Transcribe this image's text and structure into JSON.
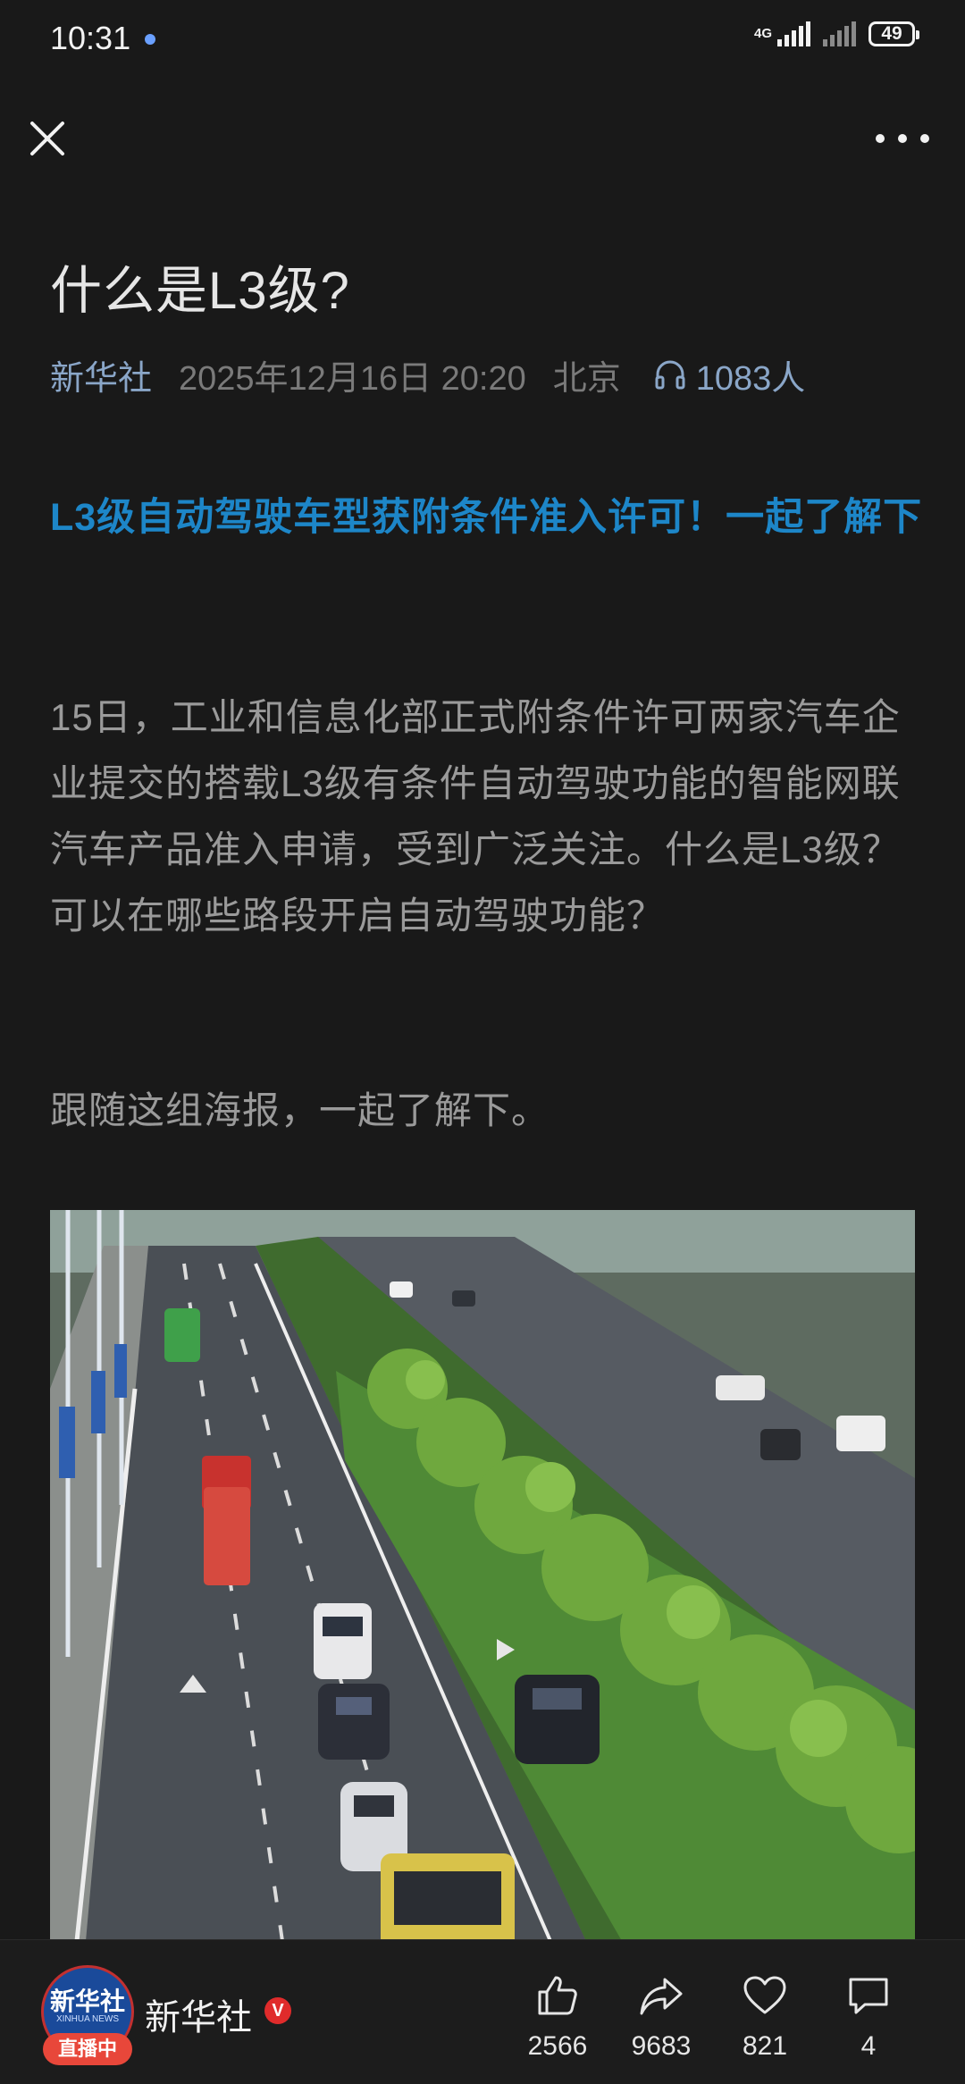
{
  "status_bar": {
    "time": "10:31",
    "network": "4G",
    "battery": "49"
  },
  "header": {
    "close_icon": "close-icon",
    "more_icon": "more-dots-icon"
  },
  "article": {
    "title": "什么是L3级?",
    "source": "新华社",
    "date": "2025年12月16日 20:20",
    "location": "北京",
    "listeners": "1083人",
    "subtitle": "L3级自动驾驶车型获附条件准入许可！一起了解下",
    "paragraphs": [
      "15日，工业和信息化部正式附条件许可两家汽车企业提交的搭载L3级有条件自动驾驶功能的智能网联汽车产品准入申请，受到广泛关注。什么是L3级？可以在哪些路段开启自动驾驶功能？",
      "跟随这组海报，一起了解下。"
    ]
  },
  "bottom_bar": {
    "avatar_text": "新华社",
    "avatar_sub": "XINHUA NEWS",
    "live_label": "直播中",
    "author": "新华社",
    "verified": "V",
    "likes": "2566",
    "shares": "9683",
    "favorites": "821",
    "comments": "4"
  },
  "colors": {
    "background": "#191919",
    "link_blue": "#1d86c8",
    "meta_blue": "#8aa6c8",
    "live_red": "#e8473a"
  }
}
